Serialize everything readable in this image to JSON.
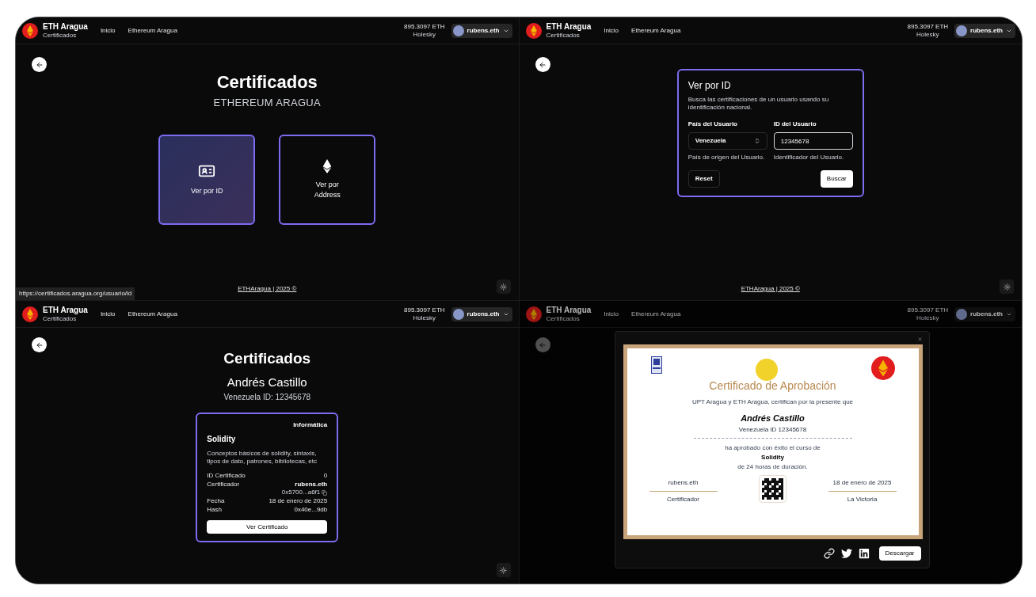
{
  "panels": [
    {
      "kind": "home",
      "header": {
        "brand": "ETH Aragua",
        "brand_sub": "Certificados",
        "nav": [
          "Inicio",
          "Ethereum Aragua"
        ],
        "balance": "895.3097",
        "unit": "ETH",
        "network": "Holesky",
        "account": "rubens.eth",
        "dimmed": false
      },
      "title": "Certificados",
      "subtitle": "ETHEREUM ARAGUA",
      "options": [
        {
          "kind": "id",
          "label": "Ver por ID",
          "selected": true
        },
        {
          "kind": "address",
          "label": "Ver por Address",
          "selected": false
        }
      ],
      "footer": "ETHAragua | 2025 ©",
      "status_url": "https://certificados.aragua.org/usuario/id"
    },
    {
      "kind": "search",
      "header": {
        "brand": "ETH Aragua",
        "brand_sub": "Certificados",
        "nav": [
          "Inicio",
          "Ethereum Aragua"
        ],
        "balance": "895.3097",
        "unit": "ETH",
        "network": "Holesky",
        "account": "rubens.eth",
        "dimmed": false
      },
      "form": {
        "title": "Ver por ID",
        "description": "Busca las certificaciones de un usuario usando su identificación nacional.",
        "country_label": "País del Usuario",
        "country": "Venezuela",
        "country_hint": "País de origen del Usuario.",
        "id_label": "ID del Usuario",
        "id_value": "12345678",
        "id_hint": "Identificador del Usuario.",
        "reset": "Reset",
        "submit": "Buscar"
      },
      "footer": "ETHAragua | 2025 ©"
    },
    {
      "kind": "results",
      "header": {
        "brand": "ETH Aragua",
        "brand_sub": "Certificados",
        "nav": [
          "Inicio",
          "Ethereum Aragua"
        ],
        "balance": "895.3097",
        "unit": "ETH",
        "network": "Holesky",
        "account": "rubens.eth",
        "dimmed": false
      },
      "title": "Certificados",
      "name": "Andrés Castillo",
      "person_id": "Venezuela ID: 12345678",
      "card": {
        "category": "Informática",
        "course": "Solidity",
        "description": "Conceptos básicos de solidity, sintaxis, tipos de dato, patrones, bibliotecas, etc",
        "rows": [
          {
            "label": "ID Certificado",
            "value": "0"
          },
          {
            "label": "Certificador",
            "value": "rubens.eth",
            "sub": "0x5700...a6f1"
          },
          {
            "label": "Fecha",
            "value": "18 de enero de 2025"
          },
          {
            "label": "Hash",
            "value": "0x40e...9db"
          }
        ],
        "button": "Ver Certificado"
      }
    },
    {
      "kind": "modal",
      "header": {
        "brand": "ETH Aragua",
        "brand_sub": "Certificados",
        "nav": [
          "Inicio",
          "Ethereum Aragua"
        ],
        "balance": "895.3097",
        "unit": "ETH",
        "network": "Holesky",
        "account": "rubens.eth",
        "dimmed": true
      },
      "certificate": {
        "title": "Certificado de Aprobación",
        "intro": "UPT Aragua y ETH Aragua, certifican por la presente que",
        "name": "Andrés Castillo",
        "person_id": "Venezuela ID 12345678",
        "passed": "ha aprobado con éxito el curso de",
        "course": "Solidity",
        "duration": "de 24 horas de duración.",
        "signer": "rubens.eth",
        "signer_role": "Certificador",
        "date": "18 de enero de 2025",
        "place": "La Victoria"
      },
      "download": "Descargar"
    }
  ]
}
